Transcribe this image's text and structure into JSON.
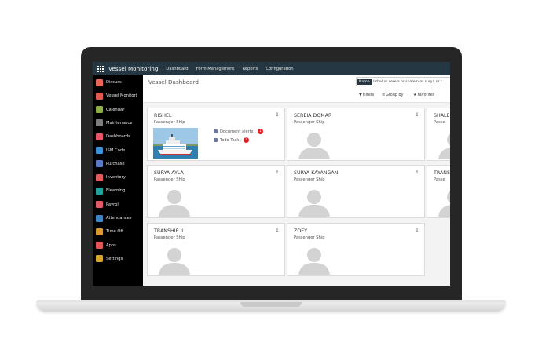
{
  "colors": {
    "navbar": "#243742",
    "sidebar": "#000000",
    "badge": "#e01b24",
    "laptop_frame": "#262626"
  },
  "app": {
    "title": "Vessel Monitoring",
    "nav": [
      "Dashboard",
      "Form Management",
      "Reports",
      "Configuration"
    ]
  },
  "sidebar": {
    "items": [
      {
        "label": "Discuss",
        "color": "#e8665a",
        "icon": "discuss-icon"
      },
      {
        "label": "Vessel Monitori",
        "color": "#e05a4f",
        "icon": "vessel-icon"
      },
      {
        "label": "Calendar",
        "color": "#8fae4a",
        "icon": "calendar-icon"
      },
      {
        "label": "Maintenance",
        "color": "#7d7d7d",
        "icon": "wrench-icon"
      },
      {
        "label": "Dashboards",
        "color": "#e8566c",
        "icon": "dashboard-icon"
      },
      {
        "label": "ISM Code",
        "color": "#3d8fd6",
        "icon": "ism-code-icon"
      },
      {
        "label": "Purchase",
        "color": "#5b7bc9",
        "icon": "purchase-icon"
      },
      {
        "label": "Inventory",
        "color": "#e35b5b",
        "icon": "inventory-icon"
      },
      {
        "label": "Elearning",
        "color": "#1fa39a",
        "icon": "elearning-icon"
      },
      {
        "label": "Payroll",
        "color": "#e35b6b",
        "icon": "payroll-icon"
      },
      {
        "label": "Attendances",
        "color": "#3e85c8",
        "icon": "attendances-icon"
      },
      {
        "label": "Time Off",
        "color": "#d79a35",
        "icon": "time-off-icon"
      },
      {
        "label": "Apps",
        "color": "#e05555",
        "icon": "apps-icon"
      },
      {
        "label": "Settings",
        "color": "#d4a52a",
        "icon": "settings-icon"
      }
    ]
  },
  "control_panel": {
    "title": "Vessel Dashboard",
    "search_facet": "Name",
    "search_value": "rishel or sereia or shalem or surya or t",
    "filters_label": "Filters",
    "group_by_label": "Group By",
    "favorites_label": "Favorites"
  },
  "cards": [
    {
      "name": "RISHEL",
      "type": "Passenger Ship",
      "has_photo": true,
      "doc_alerts_label": "Document alerts :",
      "doc_alerts_count": "1",
      "todo_label": "Todo Task :",
      "todo_count": "2"
    },
    {
      "name": "SEREIA DOMAR",
      "type": "Passenger Ship",
      "has_photo": false
    },
    {
      "name": "SHALE",
      "type": "Passe",
      "has_photo": false
    },
    {
      "name": "SURYA AYLA",
      "type": "Passenger Ship",
      "has_photo": false
    },
    {
      "name": "SURYA KAYANGAN",
      "type": "Passenger Ship",
      "has_photo": false
    },
    {
      "name": "TRANS",
      "type": "Passe",
      "has_photo": false
    },
    {
      "name": "TRANSHIP II",
      "type": "Passenger Ship",
      "has_photo": false
    },
    {
      "name": "ZOEY",
      "type": "Passenger Ship",
      "has_photo": false
    }
  ]
}
